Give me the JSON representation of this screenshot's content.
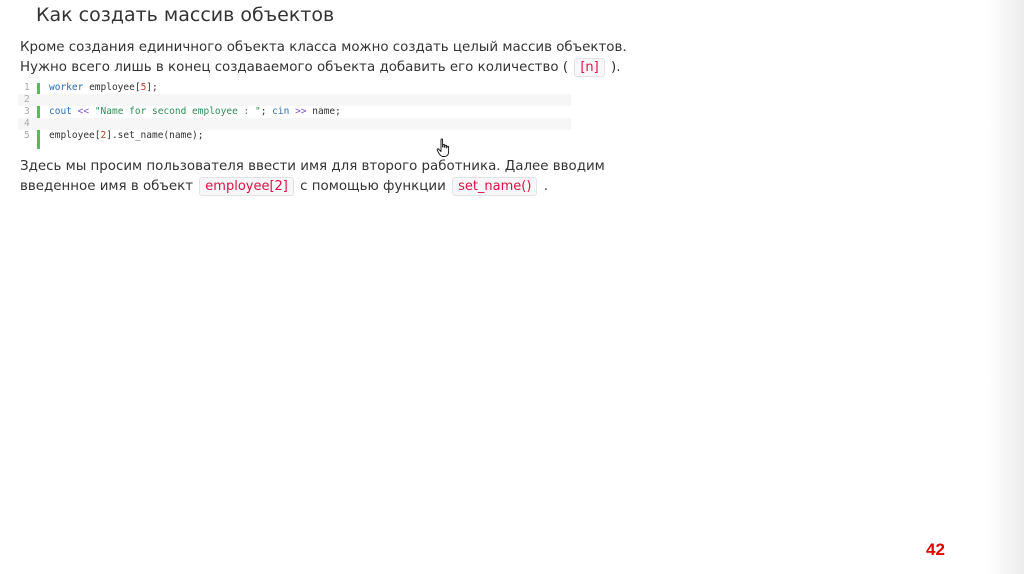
{
  "title": "Как создать массив объектов",
  "intro": {
    "line1": "Кроме создания единичного объекта класса можно создать целый массив объектов.",
    "line2_before": "Нужно всего лишь в конец создаваемого объекта добавить его количество (",
    "line2_code": "[n]",
    "line2_after": ")."
  },
  "code": {
    "line_numbers": [
      "1",
      "2",
      "3",
      "4",
      "5"
    ],
    "line1": {
      "type": "worker",
      "name": "employee",
      "open": "[",
      "size": "5",
      "close": "];"
    },
    "line3": {
      "cout": "cout",
      "op1": "<<",
      "string": "\"Name for second employee : \"",
      "semi": ";",
      "cin": "cin",
      "op2": ">>",
      "var": "name",
      "end": ";"
    },
    "line5": {
      "obj": "employee",
      "open": "[",
      "index": "2",
      "rest": "].set_name(",
      "arg": "name",
      "end": ");"
    }
  },
  "explanation": {
    "line1": "Здесь мы просим пользователя ввести имя для второго работника. Далее вводим",
    "line2_before": "введенное имя в объект",
    "code1": "employee[2]",
    "line2_middle": "с помощью функции",
    "code2": "set_name()",
    "line2_after": "."
  },
  "page_number": "42",
  "cursor_icon": "hand-pointer-icon",
  "colors": {
    "inline_code": "#dd1144",
    "gutter_bar": "#5cb85c",
    "page_number": "#e00000"
  }
}
